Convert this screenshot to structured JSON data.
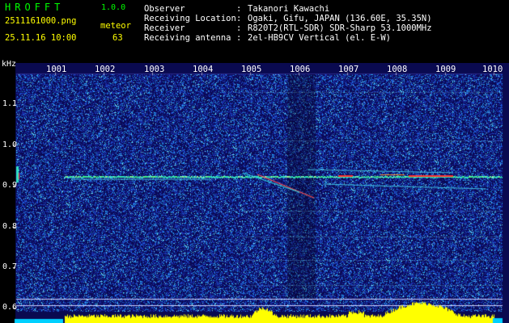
{
  "app": {
    "title": "HROFFT",
    "version": "1.0.0"
  },
  "file": {
    "name": "2511161000.png",
    "datetime": "25.11.16 10:00"
  },
  "meteor": {
    "label": "meteor",
    "count": "63"
  },
  "info": [
    {
      "label": "Observer",
      "value": "Takanori Kawachi"
    },
    {
      "label": "Receiving Location",
      "value": "Ogaki, Gifu, JAPAN (136.60E, 35.35N)"
    },
    {
      "label": "Receiver",
      "value": "R820T2(RTL-SDR) SDR-Sharp 53.1000MHz"
    },
    {
      "label": "Receiving antenna",
      "value": "2el-HB9CV Vertical (el. E-W)"
    }
  ],
  "axes": {
    "y_unit": "kHz",
    "y_ticks": [
      "1.1",
      "1.0",
      "0.9",
      "0.8",
      "0.7",
      "0.6"
    ],
    "x_ticks": [
      "1001",
      "1002",
      "1003",
      "1004",
      "1005",
      "1006",
      "1007",
      "1008",
      "1009",
      "1010"
    ]
  },
  "colors": {
    "background": "#0a0a55",
    "signal": "#00e0e0",
    "peak": "#ff3030",
    "histogram": "#ffff00",
    "text": "#ffffff",
    "title": "#00ff00"
  },
  "chart_data": {
    "type": "heatmap",
    "y_unit": "kHz",
    "ylim": [
      0.58,
      1.2
    ],
    "x_ticks": [
      "1001",
      "1002",
      "1003",
      "1004",
      "1005",
      "1006",
      "1007",
      "1008",
      "1009",
      "1010"
    ],
    "y_ticks": [
      1.1,
      1.0,
      0.9,
      0.8,
      0.7,
      0.6
    ],
    "main_line_khz": 0.92
  }
}
